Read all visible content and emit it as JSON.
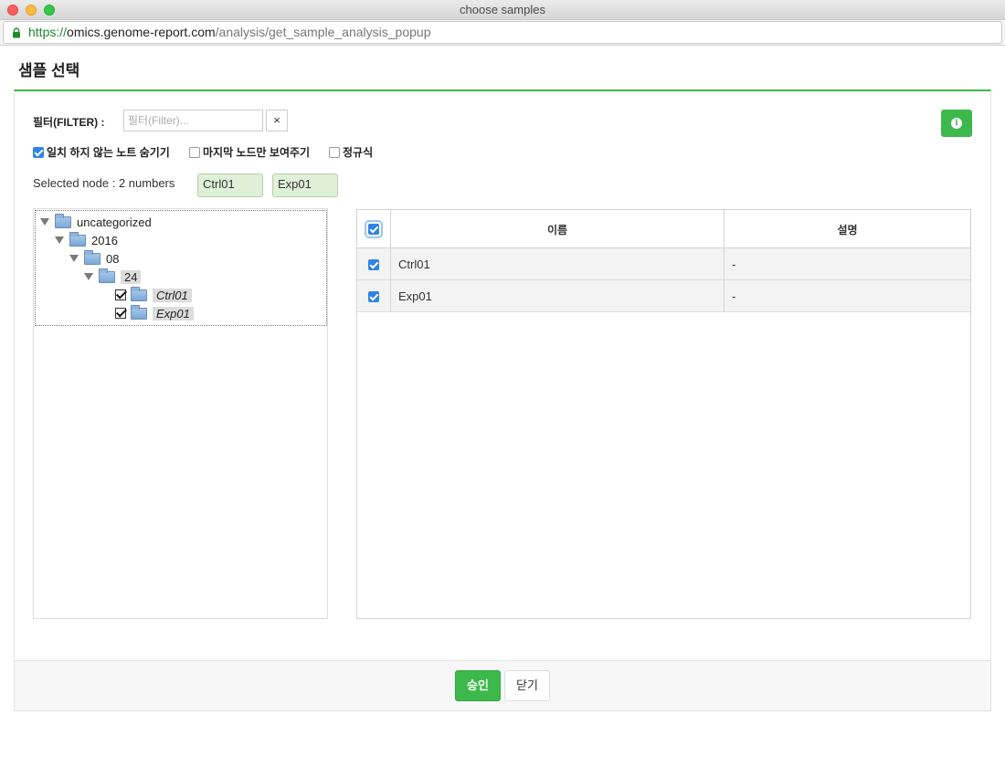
{
  "window": {
    "title": "choose samples",
    "url_scheme": "https://",
    "url_host": "omics.genome-report.com",
    "url_path": "/analysis/get_sample_analysis_popup"
  },
  "page": {
    "title": "샘플 선택"
  },
  "filter": {
    "label": "필터(FILTER) :",
    "placeholder": "필터(Filter)...",
    "value": "",
    "clear_label": "×"
  },
  "options": [
    {
      "label": "일치 하지 않는 노트 숨기기",
      "checked": true
    },
    {
      "label": "마지막 노드만 보여주기",
      "checked": false
    },
    {
      "label": "정규식",
      "checked": false
    }
  ],
  "selection": {
    "summary": "Selected node : 2 numbers",
    "chips": [
      "Ctrl01",
      "Exp01"
    ]
  },
  "tree": {
    "root": "uncategorized",
    "year": "2016",
    "month": "08",
    "day": "24",
    "leaves": [
      "Ctrl01",
      "Exp01"
    ]
  },
  "table": {
    "headers": {
      "name": "이름",
      "description": "설명"
    },
    "rows": [
      {
        "name": "Ctrl01",
        "description": "-"
      },
      {
        "name": "Exp01",
        "description": "-"
      }
    ]
  },
  "footer": {
    "approve_label": "승인",
    "close_label": "닫기"
  },
  "colors": {
    "accent": "#3cb94a",
    "checkbox": "#2f84e5",
    "chip_bg": "#dff0d8"
  }
}
